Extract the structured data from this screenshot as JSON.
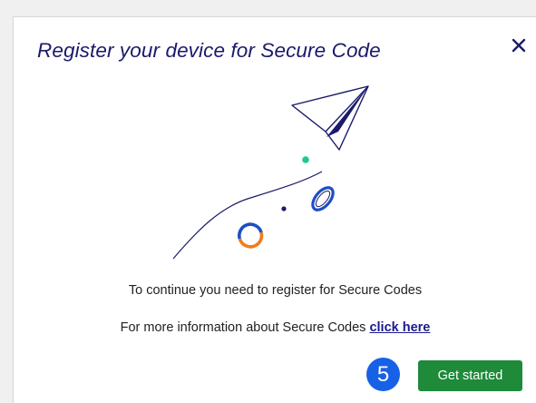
{
  "dialog": {
    "title": "Register your device for Secure Code",
    "close_icon": "close-icon",
    "illustration_icon": "paper-plane-illustration",
    "message": "To continue you need to register for Secure Codes",
    "info_text": "For more information about Secure Codes",
    "info_link": "click here",
    "step_badge": "5",
    "get_started_label": "Get started"
  },
  "colors": {
    "title": "#1b1a6b",
    "plane": "#1b1a6b",
    "ring_orange": "#f07d1a",
    "ring_blue": "#1d4fc4",
    "dot_green": "#1fc792",
    "step_badge": "#1761e6",
    "button": "#1e8a3a"
  }
}
